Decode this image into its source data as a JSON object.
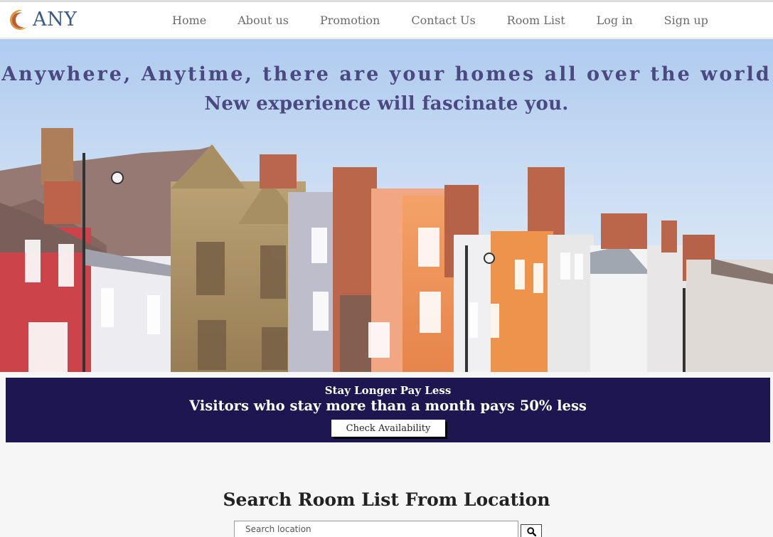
{
  "brand": {
    "name": "ANY",
    "logo_colors": {
      "outer": "#d99a3a",
      "inner": "#c05a3a",
      "text": "#3b5b86"
    }
  },
  "nav": {
    "items": [
      {
        "label": "Home"
      },
      {
        "label": "About us"
      },
      {
        "label": "Promotion"
      },
      {
        "label": "Contact Us"
      },
      {
        "label": "Room List"
      },
      {
        "label": "Log in"
      },
      {
        "label": "Sign up"
      }
    ]
  },
  "hero": {
    "title": "Anywhere, Anytime, there are your homes all over the world",
    "subtitle": "New experience will fascinate you.",
    "text_color": "#4a4a80",
    "image": "row-of-colorful-townhouses"
  },
  "promo": {
    "kicker": "Stay Longer Pay Less",
    "headline": "Visitors who stay more than a month pays 50% less",
    "button_label": "Check Availability",
    "background": "#1d1650"
  },
  "search": {
    "title": "Search Room List From Location",
    "placeholder": "Search location",
    "value": "",
    "button_icon": "search-icon"
  }
}
